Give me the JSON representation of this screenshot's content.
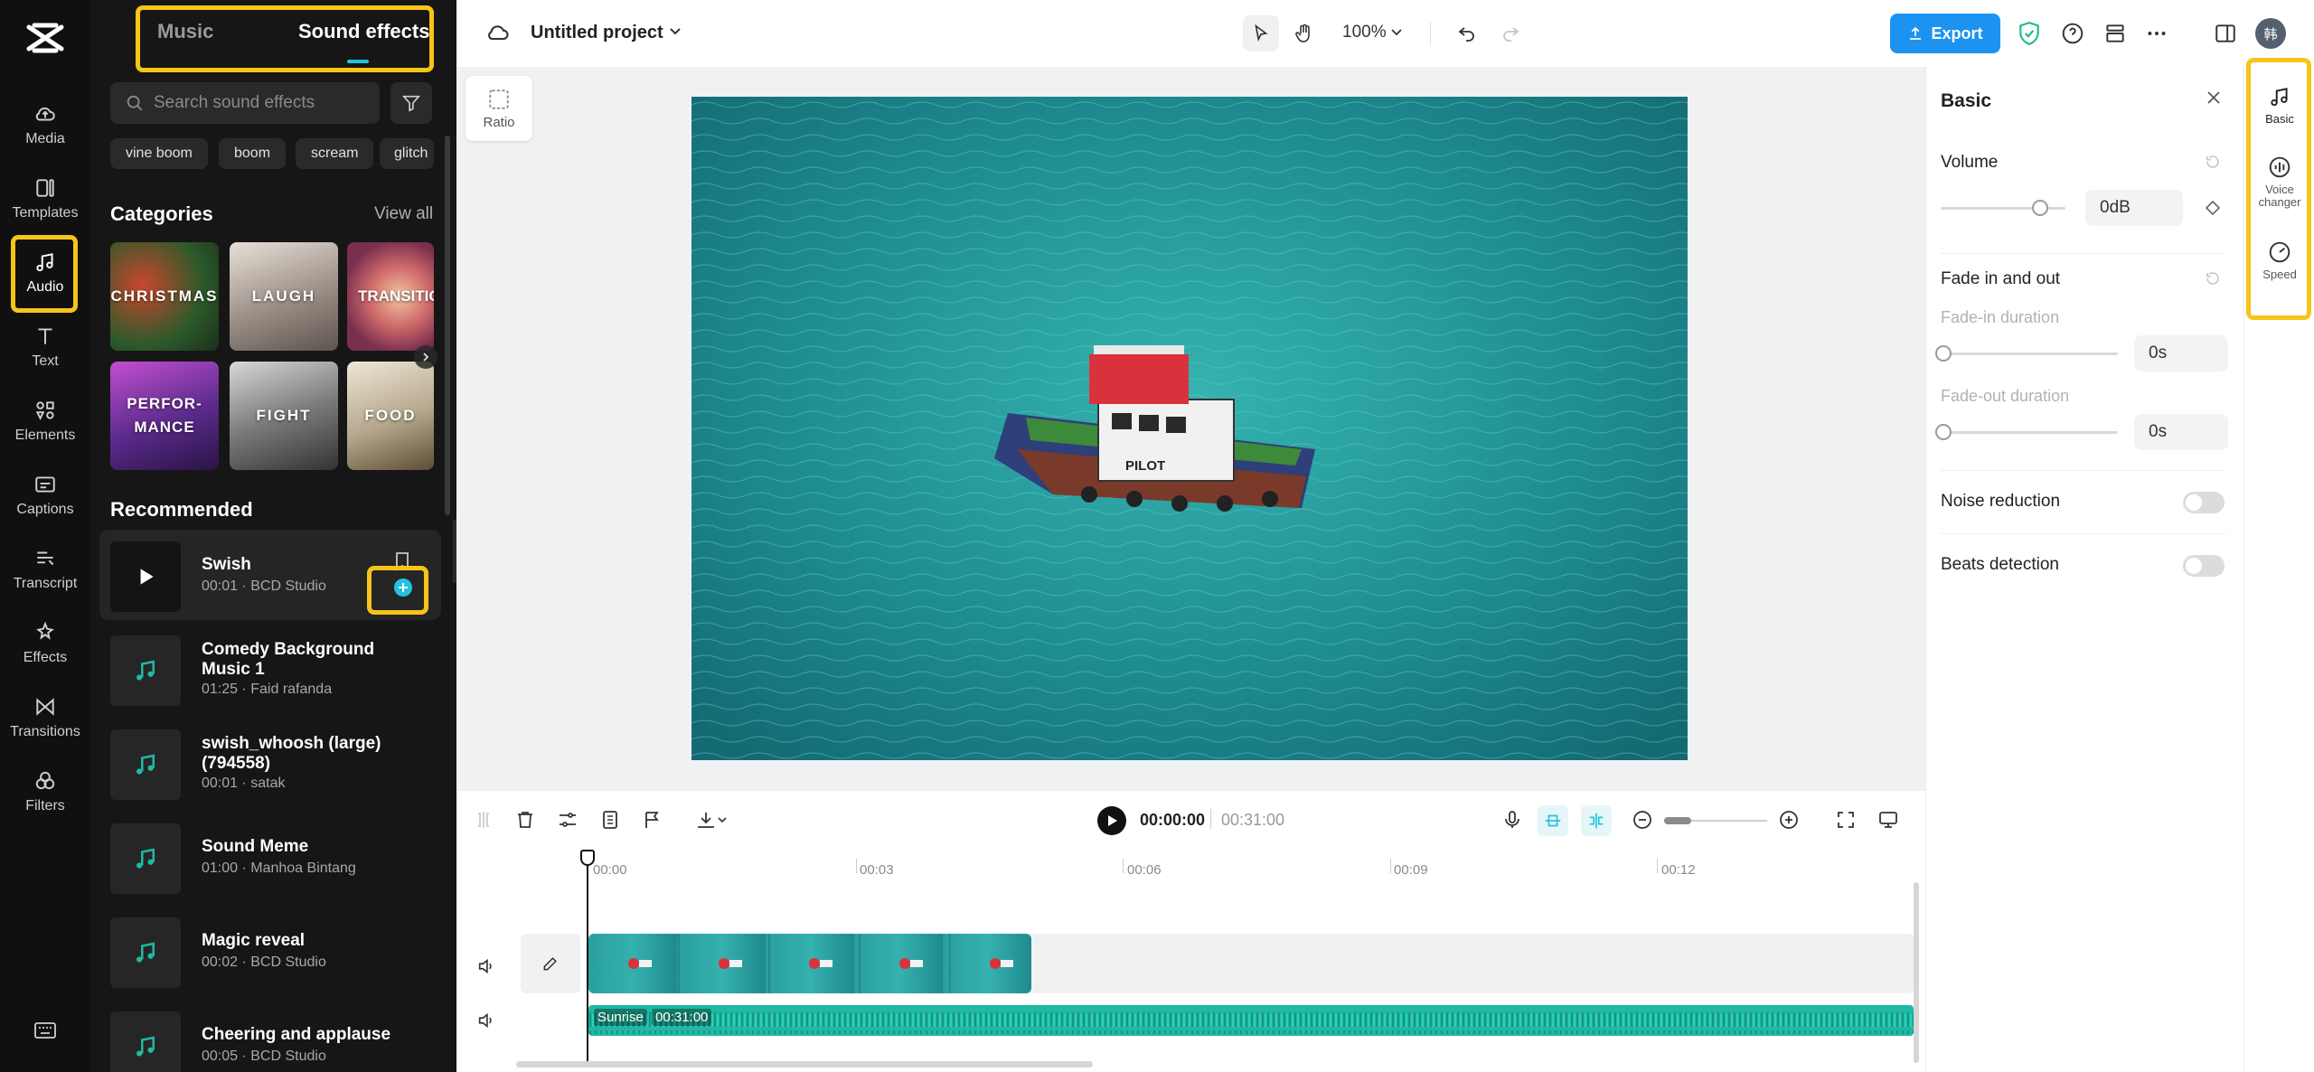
{
  "sidebar": {
    "items": [
      {
        "label": "Media",
        "icon": "cloud-upload-icon"
      },
      {
        "label": "Templates",
        "icon": "templates-icon"
      },
      {
        "label": "Audio",
        "icon": "music-note-icon"
      },
      {
        "label": "Text",
        "icon": "text-icon"
      },
      {
        "label": "Elements",
        "icon": "elements-icon"
      },
      {
        "label": "Captions",
        "icon": "captions-icon"
      },
      {
        "label": "Transcript",
        "icon": "transcript-icon"
      },
      {
        "label": "Effects",
        "icon": "effects-icon"
      },
      {
        "label": "Transitions",
        "icon": "transitions-icon"
      },
      {
        "label": "Filters",
        "icon": "filters-icon"
      }
    ]
  },
  "audio_panel": {
    "tabs": [
      "Music",
      "Sound effects"
    ],
    "search_placeholder": "Search sound effects",
    "chips": [
      "vine boom",
      "boom",
      "scream",
      "glitch"
    ],
    "categories_title": "Categories",
    "view_all": "View all",
    "categories": [
      "CHRISTMAS",
      "LAUGH",
      "TRANSITIO",
      "PERFOR-\nMANCE",
      "FIGHT",
      "FOOD"
    ],
    "recommended_title": "Recommended",
    "tracks": [
      {
        "title": "Swish",
        "meta": "00:01 · BCD Studio"
      },
      {
        "title": "Comedy Background Music 1",
        "meta": "01:25 · Faid rafanda"
      },
      {
        "title": "swish_whoosh (large) (794558)",
        "meta": "00:01 · satak"
      },
      {
        "title": "Sound Meme",
        "meta": "01:00 · Manhoa Bintang"
      },
      {
        "title": "Magic reveal",
        "meta": "00:02 · BCD Studio"
      },
      {
        "title": "Cheering and applause",
        "meta": "00:05 · BCD Studio"
      }
    ]
  },
  "topbar": {
    "project_name": "Untitled project",
    "zoom": "100%",
    "export_label": "Export",
    "avatar_initial": "韩"
  },
  "canvas": {
    "ratio_label": "Ratio",
    "boat_label": "PILOT"
  },
  "properties": {
    "title": "Basic",
    "volume_label": "Volume",
    "volume_value": "0dB",
    "fade_label": "Fade in and out",
    "fade_in_label": "Fade-in duration",
    "fade_in_value": "0s",
    "fade_out_label": "Fade-out duration",
    "fade_out_value": "0s",
    "noise_label": "Noise reduction",
    "beats_label": "Beats detection"
  },
  "right_rail": [
    "Basic",
    "Voice changer",
    "Speed"
  ],
  "timeline": {
    "current_time": "00:00:00",
    "total_time": "00:31:00",
    "ruler": [
      "00:00",
      "00:03",
      "00:06",
      "00:09",
      "00:12"
    ],
    "audio_clip_name": "Sunrise",
    "audio_clip_duration": "00:31:00"
  },
  "colors": {
    "accent": "#1d93f1",
    "highlight": "#f5c518",
    "audio_track": "#1fb9a4"
  }
}
